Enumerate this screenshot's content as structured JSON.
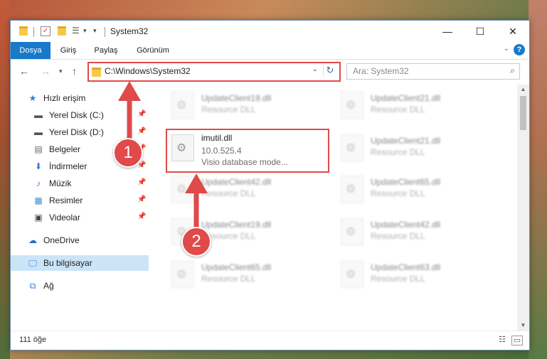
{
  "window": {
    "title": "System32"
  },
  "ribbon": {
    "tabs": [
      "Dosya",
      "Giriş",
      "Paylaş",
      "Görünüm"
    ],
    "help": "?"
  },
  "nav": {
    "address": "C:\\Windows\\System32",
    "search_placeholder": "Ara: System32"
  },
  "sidebar": {
    "items": [
      {
        "label": "Hızlı erişim",
        "icon": "star-icon"
      },
      {
        "label": "Yerel Disk (C:)",
        "icon": "drive-icon",
        "pinned": true
      },
      {
        "label": "Yerel Disk (D:)",
        "icon": "drive-icon",
        "pinned": true
      },
      {
        "label": "Belgeler",
        "icon": "document-icon",
        "pinned": true
      },
      {
        "label": "İndirmeler",
        "icon": "download-icon",
        "pinned": true
      },
      {
        "label": "Müzik",
        "icon": "music-icon",
        "pinned": true
      },
      {
        "label": "Resimler",
        "icon": "pictures-icon",
        "pinned": true
      },
      {
        "label": "Videolar",
        "icon": "video-icon",
        "pinned": true
      },
      {
        "label": "OneDrive",
        "icon": "cloud-icon"
      },
      {
        "label": "Bu bilgisayar",
        "icon": "computer-icon",
        "selected": true
      },
      {
        "label": "Ağ",
        "icon": "network-icon"
      }
    ]
  },
  "files": {
    "left": [
      {
        "name": "UpdateClient19.dll",
        "line1": "Resource DLL"
      },
      {
        "name": "imutil.dll",
        "line1": "10.0.525.4",
        "line2": "Visio database mode...",
        "highlighted": true
      },
      {
        "name": "UpdateClient42.dll",
        "line1": "Resource DLL"
      },
      {
        "name": "UpdateClient19.dll",
        "line1": "Resource DLL"
      },
      {
        "name": "UpdateClient65.dll",
        "line1": "Resource DLL"
      }
    ],
    "right": [
      {
        "name": "UpdateClient21.dll",
        "line1": "Resource DLL"
      },
      {
        "name": "UpdateClient21.dll",
        "line1": "Resource DLL"
      },
      {
        "name": "UpdateClient65.dll",
        "line1": "Resource DLL"
      },
      {
        "name": "UpdateClient42.dll",
        "line1": "Resource DLL"
      },
      {
        "name": "UpdateClient63.dll",
        "line1": "Resource DLL"
      }
    ]
  },
  "status": {
    "count": "111 öğe"
  },
  "annotations": {
    "step1": "1",
    "step2": "2",
    "color": "#e04a4a"
  }
}
